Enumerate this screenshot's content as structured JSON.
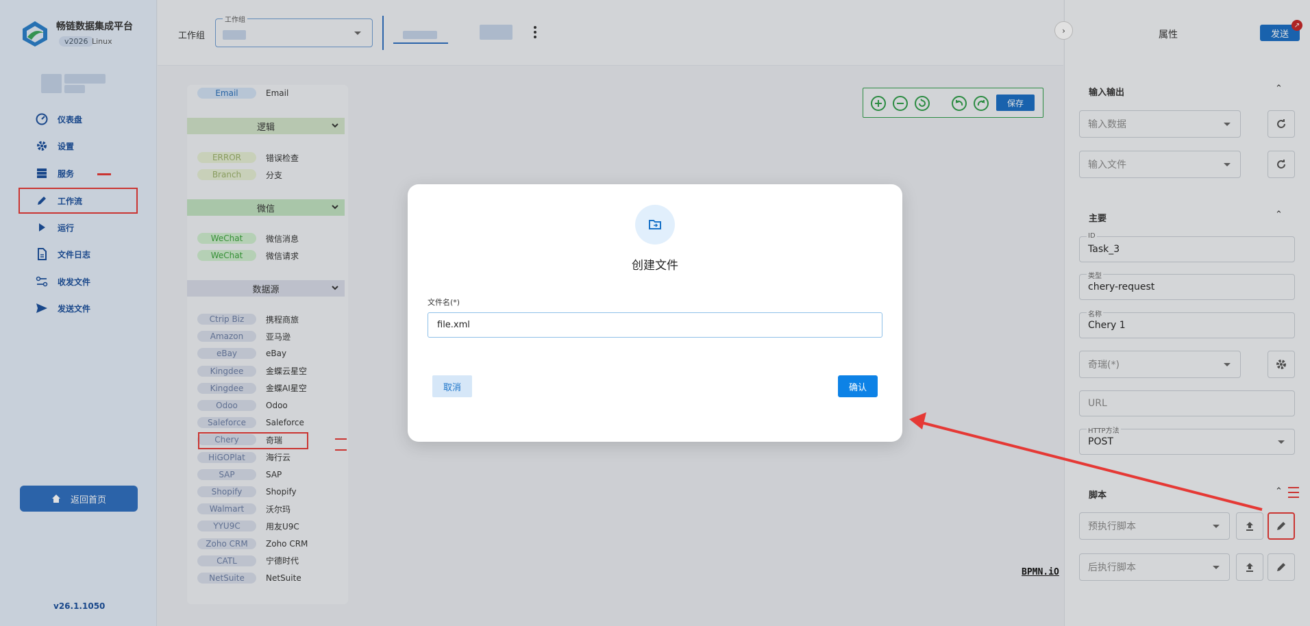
{
  "app": {
    "name": "畅链数据集成平台",
    "version_badge": "v2026",
    "os": "Linux",
    "footer_version": "v26.1.1050"
  },
  "nav": [
    {
      "label": "仪表盘",
      "icon": "dashboard-icon"
    },
    {
      "label": "设置",
      "icon": "gear-icon"
    },
    {
      "label": "服务",
      "icon": "server-icon"
    },
    {
      "label": "工作流",
      "icon": "pencil-icon",
      "active": true
    },
    {
      "label": "运行",
      "icon": "play-icon"
    },
    {
      "label": "文件日志",
      "icon": "document-icon"
    },
    {
      "label": "收发文件",
      "icon": "transfer-icon"
    },
    {
      "label": "发送文件",
      "icon": "send-icon"
    }
  ],
  "home_button": "返回首页",
  "topbar": {
    "workgroup_label": "工作组",
    "workgroup_legend": "工作组"
  },
  "palette": {
    "top_item": {
      "tag": "Email",
      "name": "Email"
    },
    "sections": [
      {
        "title": "逻辑",
        "items": [
          {
            "tag": "ERROR",
            "name": "错误检查"
          },
          {
            "tag": "Branch",
            "name": "分支"
          }
        ]
      },
      {
        "title": "微信",
        "items": [
          {
            "tag": "WeChat",
            "name": "微信消息"
          },
          {
            "tag": "WeChat",
            "name": "微信请求"
          }
        ]
      },
      {
        "title": "数据源",
        "items": [
          {
            "tag": "Ctrip Biz",
            "name": "携程商旅"
          },
          {
            "tag": "Amazon",
            "name": "亚马逊"
          },
          {
            "tag": "eBay",
            "name": "eBay"
          },
          {
            "tag": "Kingdee",
            "name": "金蝶云星空"
          },
          {
            "tag": "Kingdee",
            "name": "金蝶AI星空"
          },
          {
            "tag": "Odoo",
            "name": "Odoo"
          },
          {
            "tag": "Saleforce",
            "name": "Saleforce"
          },
          {
            "tag": "Chery",
            "name": "奇瑞"
          },
          {
            "tag": "HiGOPlat",
            "name": "海行云"
          },
          {
            "tag": "SAP",
            "name": "SAP"
          },
          {
            "tag": "Shopify",
            "name": "Shopify"
          },
          {
            "tag": "Walmart",
            "name": "沃尔玛"
          },
          {
            "tag": "YYU9C",
            "name": "用友U9C"
          },
          {
            "tag": "Zoho CRM",
            "name": "Zoho CRM"
          },
          {
            "tag": "CATL",
            "name": "宁德时代"
          },
          {
            "tag": "NetSuite",
            "name": "NetSuite"
          }
        ]
      }
    ]
  },
  "toolbar": {
    "save_label": "保存"
  },
  "bpmn_logo": "BPMN.iO",
  "properties": {
    "title": "属性",
    "send_label": "发送",
    "io": {
      "title": "输入输出",
      "input_data": "输入数据",
      "input_file": "输入文件"
    },
    "main": {
      "title": "主要",
      "id_legend": "ID",
      "id_value": "Task_3",
      "type_legend": "类型",
      "type_value": "chery-request",
      "name_legend": "名称",
      "name_value": "Chery 1",
      "connector_placeholder": "奇瑞(*)",
      "url_placeholder": "URL",
      "method_legend": "HTTP方法",
      "method_value": "POST"
    },
    "script": {
      "title": "脚本",
      "pre": "预执行脚本",
      "post": "后执行脚本"
    }
  },
  "modal": {
    "title": "创建文件",
    "field_label": "文件名(*)",
    "field_value": "file.xml",
    "cancel_label": "取消",
    "confirm_label": "确认"
  },
  "colors": {
    "accent": "#1a6ec4",
    "annotation": "#e53935",
    "green": "#2e9d48"
  }
}
